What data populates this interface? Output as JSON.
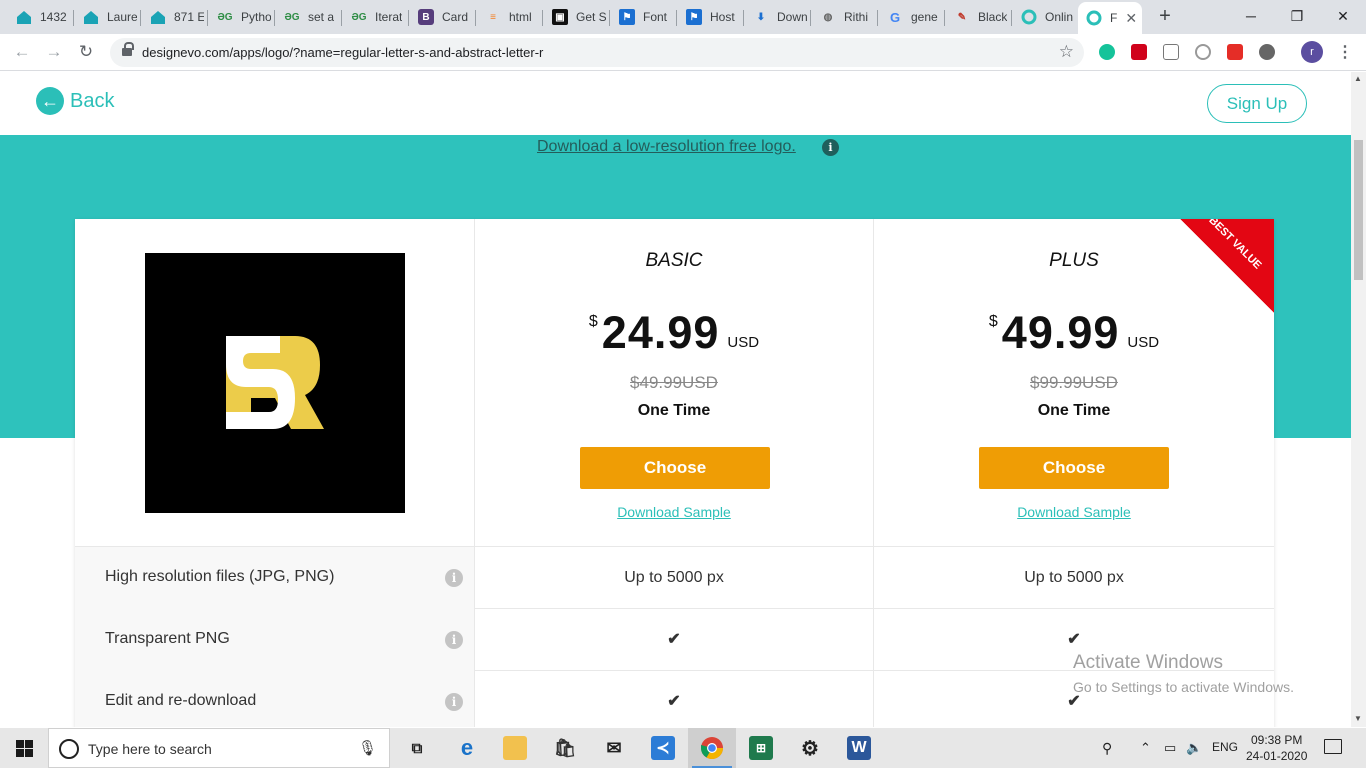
{
  "browser": {
    "tabs": [
      {
        "title": "1432",
        "favicon": "house-icon"
      },
      {
        "title": "Laure",
        "favicon": "house-icon"
      },
      {
        "title": "871 E",
        "favicon": "house-icon"
      },
      {
        "title": "Pytho",
        "favicon": "gfg-icon"
      },
      {
        "title": "set a",
        "favicon": "gfg-icon"
      },
      {
        "title": "Iterat",
        "favicon": "gfg-icon"
      },
      {
        "title": "Card",
        "favicon": "bootstrap-icon"
      },
      {
        "title": "html",
        "favicon": "stackoverflow-icon"
      },
      {
        "title": "Get S",
        "favicon": "terminal-icon"
      },
      {
        "title": "Font",
        "favicon": "flag-icon"
      },
      {
        "title": "Host",
        "favicon": "flag-icon"
      },
      {
        "title": "Down",
        "favicon": "download-icon"
      },
      {
        "title": "Rithi",
        "favicon": "globe-icon"
      },
      {
        "title": "gene",
        "favicon": "google-icon"
      },
      {
        "title": "Black",
        "favicon": "feather-icon"
      },
      {
        "title": "Onlin",
        "favicon": "designevo-icon"
      },
      {
        "title": "F",
        "favicon": "designevo-icon",
        "active": true
      }
    ],
    "url": "designevo.com/apps/logo/?name=regular-letter-s-and-abstract-letter-r",
    "profile_initial": "r"
  },
  "header": {
    "back_label": "Back",
    "signup_label": "Sign Up"
  },
  "banner": {
    "free_link": "Download a low-resolution free logo."
  },
  "logo": {
    "letters": "SR",
    "background": "#000000",
    "letter_s_color": "#ffffff",
    "letter_r_color": "#eccc4a"
  },
  "plans": [
    {
      "name": "BASIC",
      "currency": "$",
      "price": "24.99",
      "unit": "USD",
      "original_price": "$49.99USD",
      "term": "One Time",
      "cta": "Choose",
      "sample_link": "Download Sample"
    },
    {
      "name": "PLUS",
      "currency": "$",
      "price": "49.99",
      "unit": "USD",
      "original_price": "$99.99USD",
      "term": "One Time",
      "cta": "Choose",
      "sample_link": "Download Sample",
      "ribbon": "BEST VALUE"
    }
  ],
  "features": [
    {
      "label": "High resolution files (JPG, PNG)",
      "basic": "Up to 5000 px",
      "plus": "Up to 5000 px"
    },
    {
      "label": "Transparent PNG",
      "basic": "✔",
      "plus": "✔"
    },
    {
      "label": "Edit and re-download",
      "basic": "✔",
      "plus": "✔"
    }
  ],
  "watermark": {
    "line1": "Activate Windows",
    "line2": "Go to Settings to activate Windows."
  },
  "taskbar": {
    "search_placeholder": "Type here to search",
    "language": "ENG",
    "time": "09:38 PM",
    "date": "24-01-2020"
  },
  "colors": {
    "teal": "#2ec2bc",
    "accent": "#2bbfb8",
    "choose_button": "#ef9d05",
    "ribbon": "#e30613",
    "check": "#1aa34a"
  }
}
